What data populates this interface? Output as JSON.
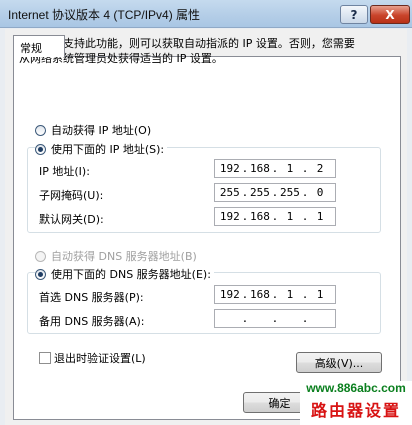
{
  "window": {
    "title": "Internet 协议版本 4 (TCP/IPv4) 属性",
    "help_button": "?",
    "close_button": "X"
  },
  "tabs": [
    {
      "label": "常规"
    }
  ],
  "description": "如果网络支持此功能，则可以获取自动指派的 IP 设置。否则，您需要从网络系统管理员处获得适当的 IP 设置。",
  "ip_section": {
    "auto_label": "自动获得 IP 地址(O)",
    "manual_label": "使用下面的 IP 地址(S):",
    "selected": "manual",
    "fields": [
      {
        "label": "IP 地址(I):",
        "value": [
          "192",
          "168",
          "1",
          "2"
        ]
      },
      {
        "label": "子网掩码(U):",
        "value": [
          "255",
          "255",
          "255",
          "0"
        ]
      },
      {
        "label": "默认网关(D):",
        "value": [
          "192",
          "168",
          "1",
          "1"
        ]
      }
    ]
  },
  "dns_section": {
    "auto_label": "自动获得 DNS 服务器地址(B)",
    "manual_label": "使用下面的 DNS 服务器地址(E):",
    "selected": "manual",
    "fields": [
      {
        "label": "首选 DNS 服务器(P):",
        "value": [
          "192",
          "168",
          "1",
          "1"
        ]
      },
      {
        "label": "备用 DNS 服务器(A):",
        "value": [
          "",
          "",
          "",
          ""
        ]
      }
    ]
  },
  "validate_checkbox": {
    "label": "退出时验证设置(L)",
    "checked": false
  },
  "buttons": {
    "advanced": "高级(V)...",
    "ok": "确定"
  },
  "watermark": {
    "url": "www.886abc.com",
    "text": "路由器设置"
  }
}
